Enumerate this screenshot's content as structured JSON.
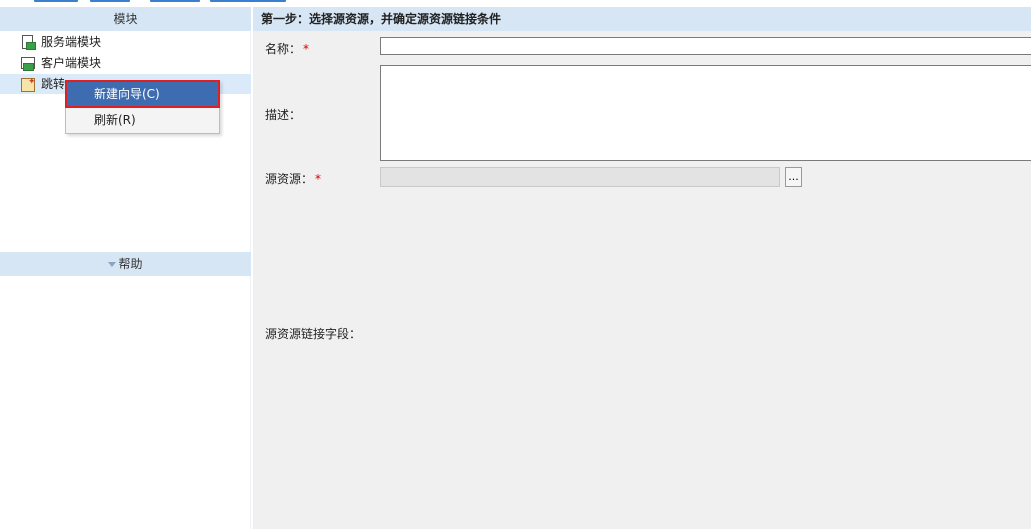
{
  "left_panel": {
    "header": "模块",
    "tree": [
      {
        "label": "服务端模块",
        "icon": "server-module-icon"
      },
      {
        "label": "客户端模块",
        "icon": "client-module-icon"
      },
      {
        "label": "跳转",
        "icon": "jump-module-icon"
      }
    ],
    "context_menu": [
      {
        "label": "新建向导(C)"
      },
      {
        "label": "刷新(R)"
      }
    ],
    "help_header": "帮助"
  },
  "right_panel": {
    "header": "第一步：选择源资源，并确定源资源链接条件",
    "name_label": "名称：",
    "name_value": "",
    "description_label": "描述：",
    "description_value": "",
    "source_label": "源资源：",
    "source_value": "",
    "browse_button": "...",
    "link_field_label": "源资源链接字段：",
    "required_mark": "*"
  },
  "colors": {
    "header_bg": "#d6e6f5",
    "menu_highlight": "#3d6db0",
    "highlight_outline": "#e02020",
    "required": "#d40000"
  }
}
